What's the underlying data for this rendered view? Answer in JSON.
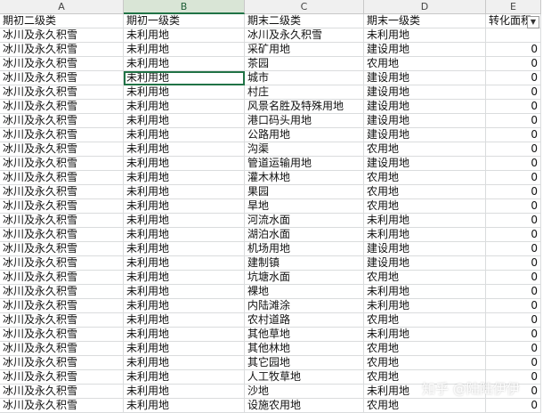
{
  "column_letters": [
    "A",
    "B",
    "C",
    "D",
    "E"
  ],
  "selected_column": "B",
  "headers": [
    "期初二级类",
    "期初一级类",
    "期末二级类",
    "期末一级类",
    "转化面积"
  ],
  "filter_icon": "chevron-down-icon",
  "rows": [
    [
      "冰川及永久积雪",
      "未利用地",
      "冰川及永久积雪",
      "未利用地",
      ""
    ],
    [
      "冰川及永久积雪",
      "未利用地",
      "采矿用地",
      "建设用地",
      "0"
    ],
    [
      "冰川及永久积雪",
      "未利用地",
      "茶园",
      "农用地",
      "0"
    ],
    [
      "冰川及永久积雪",
      "未利用地",
      "城市",
      "建设用地",
      "0"
    ],
    [
      "冰川及永久积雪",
      "未利用地",
      "村庄",
      "建设用地",
      "0"
    ],
    [
      "冰川及永久积雪",
      "未利用地",
      "风景名胜及特殊用地",
      "建设用地",
      "0"
    ],
    [
      "冰川及永久积雪",
      "未利用地",
      "港口码头用地",
      "建设用地",
      "0"
    ],
    [
      "冰川及永久积雪",
      "未利用地",
      "公路用地",
      "建设用地",
      "0"
    ],
    [
      "冰川及永久积雪",
      "未利用地",
      "沟渠",
      "农用地",
      "0"
    ],
    [
      "冰川及永久积雪",
      "未利用地",
      "管道运输用地",
      "建设用地",
      "0"
    ],
    [
      "冰川及永久积雪",
      "未利用地",
      "灌木林地",
      "农用地",
      "0"
    ],
    [
      "冰川及永久积雪",
      "未利用地",
      "果园",
      "农用地",
      "0"
    ],
    [
      "冰川及永久积雪",
      "未利用地",
      "旱地",
      "农用地",
      "0"
    ],
    [
      "冰川及永久积雪",
      "未利用地",
      "河流水面",
      "未利用地",
      "0"
    ],
    [
      "冰川及永久积雪",
      "未利用地",
      "湖泊水面",
      "未利用地",
      "0"
    ],
    [
      "冰川及永久积雪",
      "未利用地",
      "机场用地",
      "建设用地",
      "0"
    ],
    [
      "冰川及永久积雪",
      "未利用地",
      "建制镇",
      "建设用地",
      "0"
    ],
    [
      "冰川及永久积雪",
      "未利用地",
      "坑塘水面",
      "农用地",
      "0"
    ],
    [
      "冰川及永久积雪",
      "未利用地",
      "裸地",
      "未利用地",
      "0"
    ],
    [
      "冰川及永久积雪",
      "未利用地",
      "内陆滩涂",
      "未利用地",
      "0"
    ],
    [
      "冰川及永久积雪",
      "未利用地",
      "农村道路",
      "农用地",
      "0"
    ],
    [
      "冰川及永久积雪",
      "未利用地",
      "其他草地",
      "未利用地",
      "0"
    ],
    [
      "冰川及永久积雪",
      "未利用地",
      "其他林地",
      "农用地",
      "0"
    ],
    [
      "冰川及永久积雪",
      "未利用地",
      "其它园地",
      "农用地",
      "0"
    ],
    [
      "冰川及永久积雪",
      "未利用地",
      "人工牧草地",
      "农用地",
      "0"
    ],
    [
      "冰川及永久积雪",
      "未利用地",
      "沙地",
      "未利用地",
      "0"
    ],
    [
      "冰川及永久积雪",
      "未利用地",
      "设施农用地",
      "农用地",
      "0"
    ]
  ],
  "active_cell": {
    "row": 5,
    "col": 2
  },
  "watermark": "知乎 @陆陆伊伊",
  "colors": {
    "accent": "#217346",
    "header_bg": "#f0f0f0",
    "selected_header_bg": "#d9e5d6",
    "gridline": "#dadcdd"
  }
}
